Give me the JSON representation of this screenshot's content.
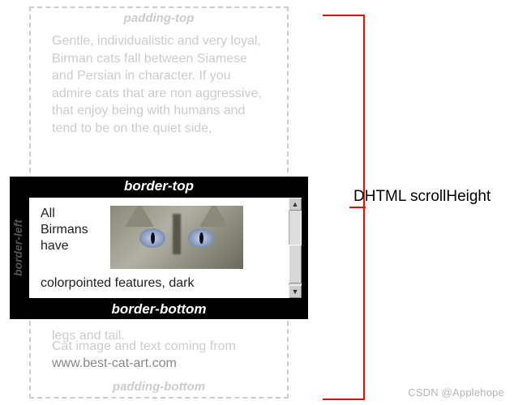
{
  "ghost": {
    "padding_top_label": "padding-top",
    "padding_bottom_label": "padding-bottom",
    "paragraph": "Gentle, individualistic and very loyal, Birman cats fall between Siamese and Persian in character. If you admire cats that are non aggressive, that enjoy being with humans and tend to be on the quiet side,",
    "fragment": "legs and tail.",
    "source_line_prefix": "Cat image and text coming from ",
    "source_link": "www.best-cat-art.com"
  },
  "viewport": {
    "border_left_label": "border-left",
    "border_top_label": "border-top",
    "border_bottom_label": "border-bottom",
    "text_before_image": "All Birmans have",
    "text_after_image": "colorpointed features, dark",
    "image_alt": "cat-face"
  },
  "scrollbar": {
    "up": "▲",
    "down": "▼"
  },
  "legend": "DHTML scrollHeight",
  "watermark": "CSDN @Applehope"
}
